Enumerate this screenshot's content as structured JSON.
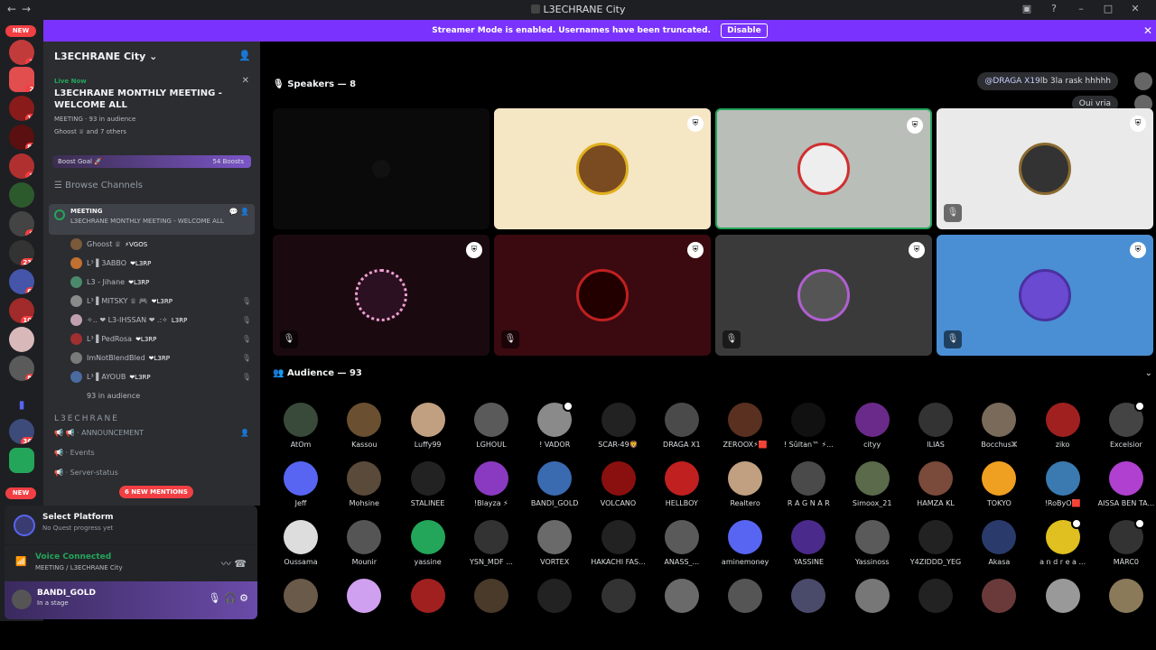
{
  "window": {
    "title": "L3ECHRANE City"
  },
  "banner": {
    "text": "Streamer Mode is enabled. Usernames have been truncated.",
    "button": "Disable"
  },
  "rail": {
    "new_top": "NEW",
    "new_bottom": "NEW",
    "badges": [
      "1",
      "2",
      "16",
      "87",
      "8",
      "8",
      "6",
      "231",
      "67",
      "109",
      "86",
      "366"
    ]
  },
  "server": {
    "name": "L3ECHRANE City",
    "live_label": "Live Now",
    "event_title": "L3ECHRANE MONTHLY MEETING - WELCOME ALL",
    "event_meta": "MEETING · 93 in audience",
    "event_others": "Ghoost ♕ and 7 others",
    "boost_label": "Boost Goal 🚀",
    "boost_count": "54 Boosts",
    "browse": "Browse Channels"
  },
  "meeting": {
    "name": "MEETING",
    "topic": "L3ECHRANE MONTHLY MEETING - WELCOME ALL",
    "users": [
      {
        "name": "Ghoost ♕",
        "tag": "⚡VGOS"
      },
      {
        "name": "L³ ▌3ABBO",
        "tag": "❤L3RP"
      },
      {
        "name": "L3 - Jihane",
        "tag": "❤L3RP"
      },
      {
        "name": "L³ ▌MITSKY ♕ 🎮",
        "tag": "❤L3RP"
      },
      {
        "name": "✧.. ❤ L3-IHSSAN ❤ .:✧",
        "tag": "L3RP"
      },
      {
        "name": "L³ ▌PedRosa",
        "tag": "❤L3RP"
      },
      {
        "name": "ImNotBlendBled",
        "tag": "❤L3RP"
      },
      {
        "name": "L³ ▌AYOUB",
        "tag": "❤L3RP"
      }
    ],
    "audience": "93 in audience"
  },
  "category": "L3ECHRANE",
  "channels": [
    "📢 · ANNOUNCEMENT",
    "· Events",
    "· Server-status"
  ],
  "mentions": "6 NEW MENTIONS",
  "quest": {
    "title": "Select Platform",
    "sub": "No Quest progress yet"
  },
  "voice": {
    "status": "Voice Connected",
    "location": "MEETING / L3ECHRANE City"
  },
  "user": {
    "name": "BANDI_GOLD",
    "status": "In a stage"
  },
  "stage": {
    "speakers_header": "Speakers — 8",
    "audience_header": "Audience — 93",
    "chat1_user": "@DRAGA X19",
    "chat1_text": "lb 3la rask hhhhh",
    "chat2_text": "Oui vria"
  },
  "audience": [
    "AtOm",
    "Kassou",
    "Luffy99",
    "LGHOUL",
    "! VADOR",
    "SCAR-49🦁",
    "DRAGA X1",
    "ZEROOX⚡🟥",
    "! Sûltan™ ⚡...",
    "cityy",
    "ILIAS",
    "Bocchusⵣ",
    "ziko",
    "Excelsior",
    "Jeff",
    "Mohsine",
    "STALINEE",
    "!Blayza ⚡",
    "BANDI_GOLD",
    "VOLCANO",
    "HELLBOY",
    "Realtero",
    "R A G N A R",
    "Simoox_21",
    "HAMZA KL",
    "TOKYO",
    "!RoByO🟥",
    "AISSA BEN TA...",
    "Oussama",
    "Mounir",
    "yassine",
    "YSN_MDF ...",
    "VORTEX",
    "HAKACHI FAS...",
    "ANASS_...",
    "aminemoney",
    "YASSINE",
    "Yassinoss",
    "Y4ZIDDD_YEG",
    "Akasa",
    "a n d r e a ...",
    "MÃRC0",
    "",
    "",
    "",
    "",
    "",
    "",
    "",
    "",
    "",
    "",
    "",
    "",
    "",
    ""
  ],
  "colors": {
    "accent": "#5865f2",
    "green": "#23a55a",
    "red": "#f23f43",
    "banner": "#7a33ff"
  }
}
